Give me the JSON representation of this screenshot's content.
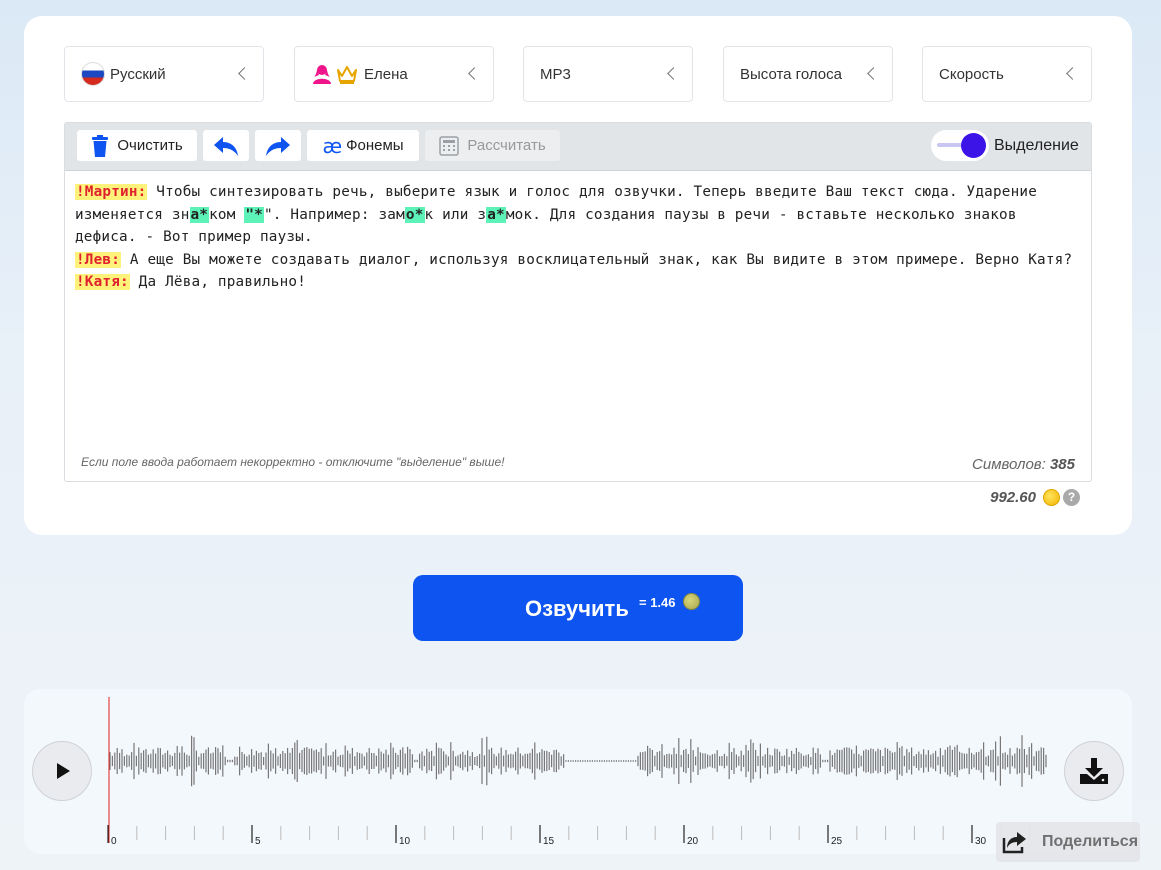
{
  "selectors": {
    "language": "Русский",
    "voice": "Елена",
    "format": "MP3",
    "pitch": "Высота голоса",
    "speed": "Скорость"
  },
  "toolbar": {
    "clear_label": "Очистить",
    "phonemes_label": "Фонемы",
    "calculate_label": "Рассчитать",
    "highlight_label": "Выделение",
    "highlight_on": true
  },
  "editor": {
    "lines": [
      [
        {
          "t": "spk",
          "v": "!Мартин:"
        },
        {
          "t": "txt",
          "v": " Чтобы синтезировать речь, выберите язык и голос для озвучки. Теперь введите Ваш текст сюда. Ударение изменяется зн"
        },
        {
          "t": "acc",
          "v": "а*"
        },
        {
          "t": "txt",
          "v": "ком "
        },
        {
          "t": "acc",
          "v": "\"*"
        },
        {
          "t": "txt",
          "v": "\". Например: зам"
        },
        {
          "t": "acc",
          "v": "о*"
        },
        {
          "t": "txt",
          "v": "к или з"
        },
        {
          "t": "acc",
          "v": "а*"
        },
        {
          "t": "txt",
          "v": "мок. Для создания паузы в речи - вставьте несколько знаков дефиса. - Вот пример паузы."
        }
      ],
      [
        {
          "t": "spk",
          "v": "!Лев:"
        },
        {
          "t": "txt",
          "v": " А еще Вы можете создавать диалог, используя восклицательный знак, как Вы видите в этом примере. Верно Катя?"
        }
      ],
      [
        {
          "t": "spk",
          "v": "!Катя:"
        },
        {
          "t": "txt",
          "v": " Да Лёва, правильно!"
        }
      ]
    ],
    "hint": "Если поле ввода работает некорректно - отключите \"выделение\" выше!",
    "chars_label": "Символов:",
    "chars_count": "385"
  },
  "balance": "992.60",
  "help_label": "?",
  "speak": {
    "label": "Озвучить",
    "cost": "= 1.46"
  },
  "player": {
    "timeline_labels": [
      "0",
      "5",
      "10",
      "15",
      "20",
      "25",
      "30"
    ],
    "share_label": "Поделиться"
  },
  "colors": {
    "accent": "#0d54f0",
    "toggle": "#3d14e8",
    "speaker_bg": "#fff27a",
    "speaker_fg": "#e0222e",
    "stress_bg": "#5df3b8",
    "playhead": "#e02020"
  },
  "icons": [
    "russia-flag-icon",
    "female-user-icon",
    "crown-icon",
    "trash-icon",
    "undo-icon",
    "redo-icon",
    "ae-icon",
    "calculator-icon",
    "coin-icon",
    "help-icon",
    "play-icon",
    "download-icon",
    "share-icon"
  ]
}
